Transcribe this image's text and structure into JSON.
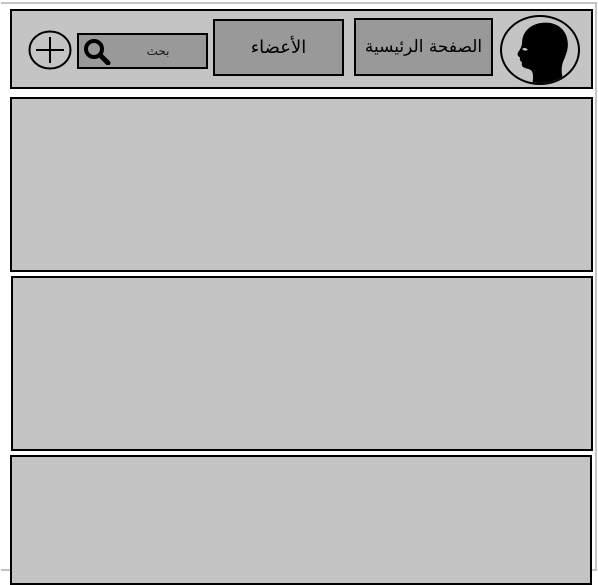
{
  "header": {
    "avatar_icon": "user-profile-silhouette-icon",
    "nav": {
      "home_label": "الصفحة الرئيسية",
      "members_label": "الأعضاء"
    },
    "search": {
      "placeholder": "بحث",
      "value": "",
      "icon": "search-icon"
    },
    "add_icon": "plus-circle-icon"
  },
  "main": {
    "panels": [
      {
        "id": "panel-1",
        "content": ""
      },
      {
        "id": "panel-2",
        "content": ""
      },
      {
        "id": "panel-3",
        "content": ""
      }
    ]
  },
  "colors": {
    "background": "#ffffff",
    "panel": "#c4c4c4",
    "button": "#999999",
    "border": "#000000"
  }
}
